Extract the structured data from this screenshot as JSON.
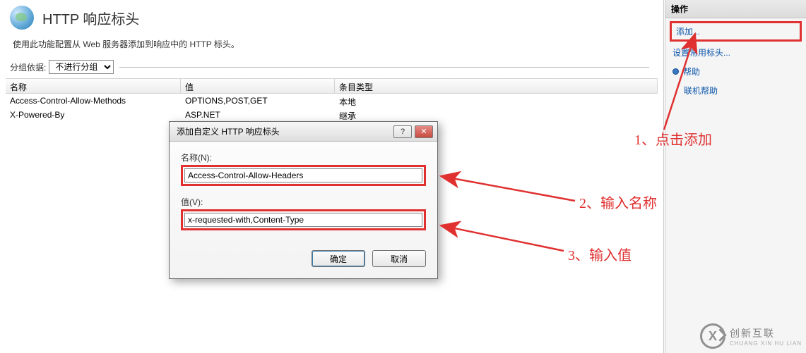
{
  "page": {
    "title": "HTTP 响应标头",
    "description": "使用此功能配置从 Web 服务器添加到响应中的 HTTP 标头。"
  },
  "group": {
    "label": "分组依据:",
    "value": "不进行分组"
  },
  "grid": {
    "columns": {
      "name": "名称",
      "value": "值",
      "type": "条目类型"
    },
    "rows": [
      {
        "name": "Access-Control-Allow-Methods",
        "value": "OPTIONS,POST,GET",
        "type": "本地"
      },
      {
        "name": "X-Powered-By",
        "value": "ASP.NET",
        "type": "继承"
      }
    ]
  },
  "dialog": {
    "title": "添加自定义 HTTP 响应标头",
    "help": "?",
    "close": "✕",
    "name_label": "名称(N):",
    "name_value": "Access-Control-Allow-Headers",
    "value_label": "值(V):",
    "value_value": "x-requested-with,Content-Type",
    "ok": "确定",
    "cancel": "取消"
  },
  "actions": {
    "header": "操作",
    "add": "添加...",
    "set_common": "设置常用标头...",
    "help": "帮助",
    "online_help": "联机帮助"
  },
  "annotations": {
    "a1": "1、点击添加",
    "a2": "2、输入名称",
    "a3": "3、输入值"
  },
  "watermark": {
    "logo": "X",
    "line1": "创新互联",
    "line2": "CHUANG XIN HU LIAN"
  }
}
